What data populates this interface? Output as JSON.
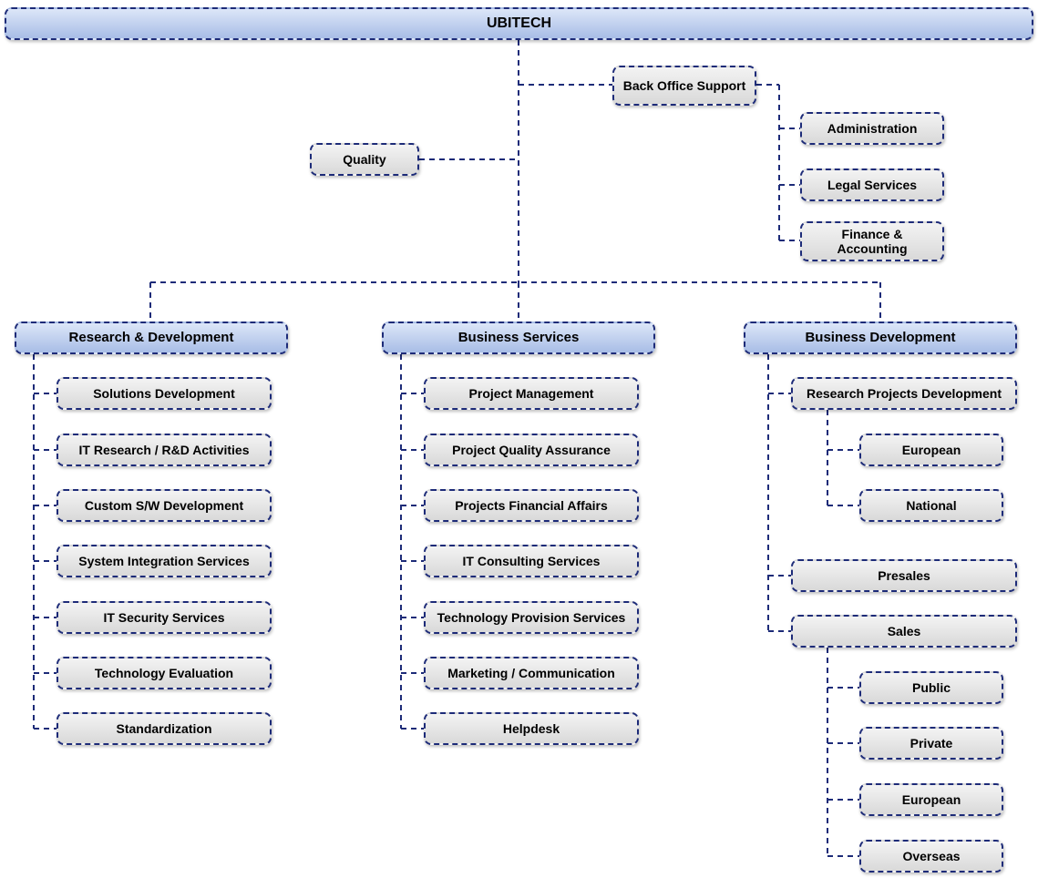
{
  "colors": {
    "line": "#1d2b78",
    "major_fill": "#b9cdee",
    "leaf_fill": "#e0e0e0"
  },
  "root": {
    "label": "UBITECH"
  },
  "staff": {
    "quality": "Quality",
    "back_office": "Back Office Support",
    "back_office_children": [
      "Administration",
      "Legal Services",
      "Finance & Accounting"
    ]
  },
  "divisions": [
    {
      "label": "Research & Development",
      "children": [
        "Solutions Development",
        "IT Research / R&D Activities",
        "Custom S/W Development",
        "System Integration Services",
        "IT Security Services",
        "Technology Evaluation",
        "Standardization"
      ]
    },
    {
      "label": "Business Services",
      "children": [
        "Project Management",
        "Project Quality Assurance",
        "Projects Financial Affairs",
        "IT Consulting Services",
        "Technology Provision Services",
        "Marketing / Communication",
        "Helpdesk"
      ]
    },
    {
      "label": "Business Development",
      "children": [
        {
          "label": "Research Projects Development",
          "children": [
            "European",
            "National"
          ]
        },
        {
          "label": "Presales"
        },
        {
          "label": "Sales",
          "children": [
            "Public",
            "Private",
            "European",
            "Overseas"
          ]
        }
      ]
    }
  ]
}
